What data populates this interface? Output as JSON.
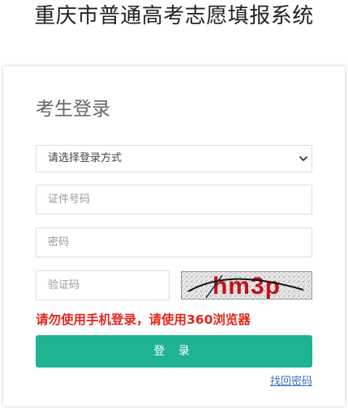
{
  "page": {
    "title": "重庆市普通高考志愿填报系统"
  },
  "login": {
    "heading": "考生登录",
    "method_select": {
      "selected": "请选择登录方式"
    },
    "id_field": {
      "placeholder": "证件号码"
    },
    "password_field": {
      "placeholder": "密码"
    },
    "captcha_field": {
      "placeholder": "验证码"
    },
    "captcha_text": "hm3p",
    "warning": "请勿使用手机登录，请使用360浏览器",
    "submit_label": "登 录",
    "forgot_password": "找回密码"
  },
  "colors": {
    "accent": "#1eb393",
    "warning": "#e3261c",
    "link": "#3a73b8",
    "captcha_text": "#c0141a"
  },
  "icons": {
    "select_arrow": "chevron-down-icon"
  }
}
